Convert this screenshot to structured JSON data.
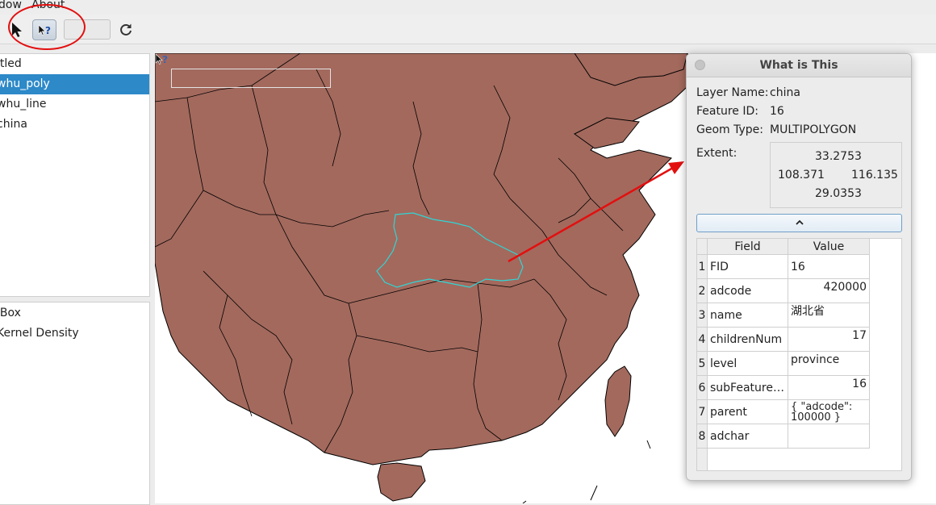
{
  "menu": {
    "window": "dow",
    "about": "About"
  },
  "layers": [
    "itled",
    "whu_poly",
    "whu_line",
    "china"
  ],
  "selected_layer": "whu_poly",
  "tools": [
    "lBox",
    "Kernel Density"
  ],
  "dialog": {
    "title": "What is This",
    "layer_name_label": "Layer Name:",
    "layer_name": "china",
    "feature_id_label": "Feature ID:",
    "feature_id": "16",
    "geom_type_label": "Geom Type:",
    "geom_type": "MULTIPOLYGON",
    "extent_label": "Extent:",
    "extent": {
      "top": "33.2753",
      "left": "108.371",
      "right": "116.135",
      "bottom": "29.0353"
    },
    "table_headers": {
      "field": "Field",
      "value": "Value"
    },
    "rows": [
      {
        "num": "1",
        "field": "FID",
        "value": "16"
      },
      {
        "num": "2",
        "field": "adcode",
        "value": "420000"
      },
      {
        "num": "3",
        "field": "name",
        "value": "湖北省"
      },
      {
        "num": "4",
        "field": "childrenNum",
        "value": "17"
      },
      {
        "num": "5",
        "field": "level",
        "value": "province"
      },
      {
        "num": "6",
        "field": "subFeature…",
        "value": "16"
      },
      {
        "num": "7",
        "field": "parent",
        "value": "{ \"adcode\": 100000 }"
      },
      {
        "num": "8",
        "field": "adchar",
        "value": ""
      }
    ]
  },
  "colors": {
    "land": "#a3695d",
    "highlight": "#2fd6d6",
    "annotation": "#e30f0f",
    "selection": "#2d89c8"
  },
  "icons": [
    "arrow-cursor-icon",
    "whats-this-icon",
    "refresh-icon",
    "chevron-up-icon",
    "help-cursor-icon"
  ]
}
